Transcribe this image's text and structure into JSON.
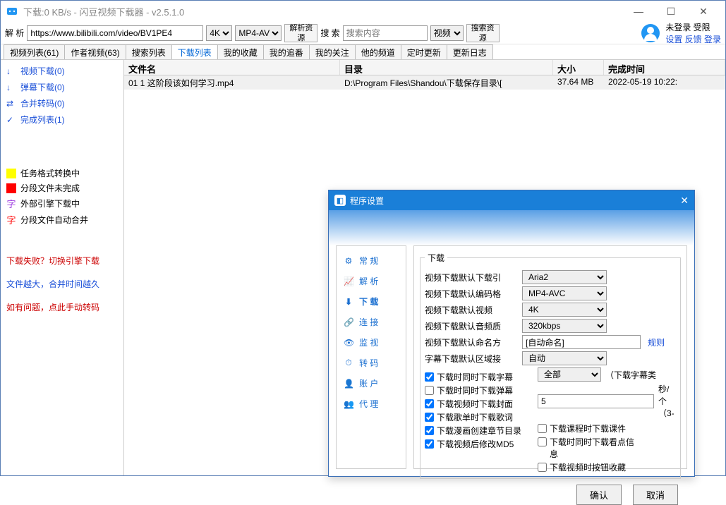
{
  "window": {
    "title": "下载:0 KB/s - 闪豆视频下载器 - v2.5.1.0"
  },
  "toolbar": {
    "parse_label": "解  析",
    "url_value": "https://www.bilibili.com/video/BV1PE4",
    "quality_value": "4K",
    "format_value": "MP4-AV",
    "parse_btn": "解析资\n源",
    "search_label": "搜  索",
    "search_placeholder": "搜索内容",
    "search_type": "视频",
    "search_btn": "搜索资\n源"
  },
  "user": {
    "status": "未登录  受限",
    "links": "设置  反馈  登录"
  },
  "main_tabs": [
    "视频列表(61)",
    "作者视频(63)",
    "搜索列表",
    "下载列表",
    "我的收藏",
    "我的追番",
    "我的关注",
    "他的频道",
    "定时更新",
    "更新日志"
  ],
  "main_tabs_active": 3,
  "sidebar": {
    "items": [
      {
        "icon": "↓",
        "label": "视频下载(0)"
      },
      {
        "icon": "↓",
        "label": "弹幕下载(0)"
      },
      {
        "icon": "⇄",
        "label": "合并转码(0)"
      },
      {
        "icon": "✓",
        "label": "完成列表(1)"
      }
    ],
    "legend": [
      {
        "type": "sq",
        "color": "#ffff00",
        "label": "任务格式转换中"
      },
      {
        "type": "sq",
        "color": "#ff0000",
        "label": "分段文件未完成"
      },
      {
        "type": "ch",
        "color": "#a040e0",
        "char": "字",
        "label": "外部引擎下载中"
      },
      {
        "type": "ch",
        "color": "#ff0000",
        "char": "字",
        "label": "分段文件自动合并"
      }
    ],
    "hints": [
      {
        "text": "下载失败？切换引擎下载",
        "cls": ""
      },
      {
        "text": "文件越大，合并时间越久",
        "cls": "blue"
      },
      {
        "text": "如有问题，点此手动转码",
        "cls": ""
      }
    ]
  },
  "table": {
    "headers": [
      "文件名",
      "目录",
      "大小",
      "完成时间"
    ],
    "rows": [
      [
        "01 1 这阶段该如何学习.mp4",
        "D:\\Program Files\\Shandou\\下载保存目录\\[",
        "37.64 MB",
        "2022-05-19 10:22:"
      ]
    ]
  },
  "dialog": {
    "title": "程序设置",
    "nav": [
      "常 规",
      "解 析",
      "下 载",
      "连 接",
      "监 视",
      "转 码",
      "账 户",
      "代 理"
    ],
    "nav_icons": [
      "⚙",
      "📈",
      "⬇",
      "🔗",
      "👁",
      "⏱",
      "👤",
      "👥"
    ],
    "nav_active": 2,
    "group_label": "下载",
    "rows": [
      {
        "label": "视频下载默认下载引",
        "value": "Aria2",
        "type": "select"
      },
      {
        "label": "视频下载默认编码格",
        "value": "MP4-AVC",
        "type": "select"
      },
      {
        "label": "视频下载默认视频",
        "value": "4K",
        "type": "select"
      },
      {
        "label": "视频下载默认音频质",
        "value": "320kbps",
        "type": "select"
      },
      {
        "label": "视频下载默认命名方",
        "value": "[自动命名]",
        "type": "text",
        "link": "规则"
      },
      {
        "label": "字幕下载默认区域接",
        "value": "自动",
        "type": "select"
      }
    ],
    "checks_left": [
      {
        "checked": true,
        "label": "下载时同时下载字幕"
      },
      {
        "checked": false,
        "label": "下载时同时下载弹幕"
      },
      {
        "checked": true,
        "label": "下载视频时下载封面"
      },
      {
        "checked": true,
        "label": "下载歌单时下载歌词"
      },
      {
        "checked": true,
        "label": "下载漫画创建章节目录"
      },
      {
        "checked": true,
        "label": "下载视频后修改MD5"
      }
    ],
    "sub_select": "全部",
    "sub_hint": "（下载字幕类",
    "spinner_value": "5",
    "spinner_hint": "秒/个   （3-",
    "checks_right": [
      {
        "checked": false,
        "label": "下载课程时下载课件"
      },
      {
        "checked": false,
        "label": "下载时同时下载看点信息"
      },
      {
        "checked": false,
        "label": "下载视频时按钮收藏"
      }
    ],
    "ok": "确认",
    "cancel": "取消"
  }
}
